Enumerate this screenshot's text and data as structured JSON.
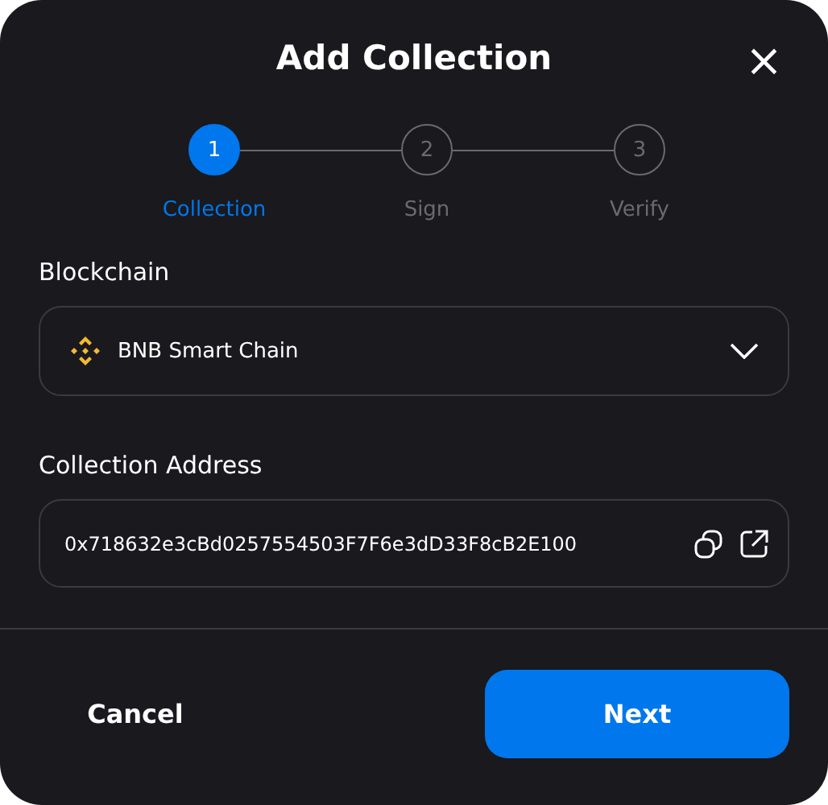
{
  "dialog": {
    "title": "Add Collection",
    "close": "×"
  },
  "steps": [
    {
      "number": "1",
      "label": "Collection",
      "selected": true
    },
    {
      "number": "2",
      "label": "Sign",
      "selected": false
    },
    {
      "number": "3",
      "label": "Verify",
      "selected": false
    }
  ],
  "blockchain": {
    "label": "Blockchain",
    "value": "BNB Smart Chain"
  },
  "address": {
    "label": "Collection Address",
    "value": "0x718632e3cBd0257554503F7F6e3dD33F8cB2E100"
  },
  "buttons": [
    {
      "kind": "secondary",
      "label": "Cancel"
    },
    {
      "kind": "primary",
      "label": "Next"
    }
  ]
}
